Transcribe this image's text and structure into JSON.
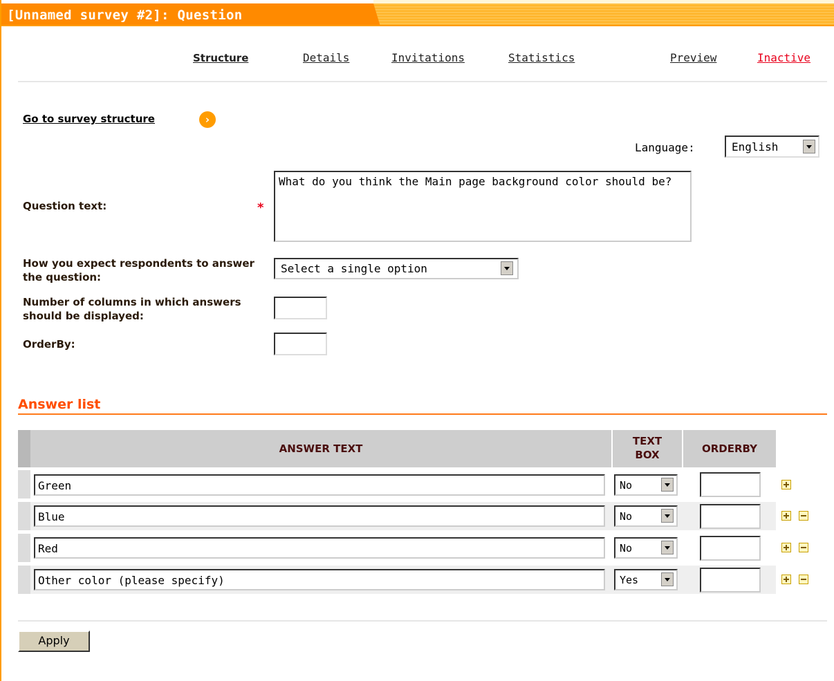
{
  "window": {
    "title": "[Unnamed survey #2]: Question"
  },
  "tabs": [
    {
      "label": "Structure",
      "active": true
    },
    {
      "label": "Details"
    },
    {
      "label": "Invitations"
    },
    {
      "label": "Statistics"
    },
    {
      "label": "Preview"
    },
    {
      "label": "Inactive",
      "color": "#e8001c"
    }
  ],
  "goto_structure": {
    "label": "Go to survey structure ",
    "icon": "arrow-right-circle-icon"
  },
  "language": {
    "label": "Language:",
    "selected": "English"
  },
  "form": {
    "question_text_label": "Question text:",
    "required_marker": "*",
    "question_text_value": "What do you think the Main page background color should be?",
    "answer_type_label": "How you expect respondents to answer the question:",
    "answer_type_selected": "Select a single option",
    "columns_label": "Number of columns in which answers should be displayed:",
    "columns_value": "",
    "orderby_label": "OrderBy:",
    "orderby_value": ""
  },
  "answer_list": {
    "title": "Answer list",
    "headers": {
      "answer_text": "ANSWER TEXT",
      "text_box": "TEXT BOX",
      "orderby": "ORDERBY"
    },
    "rows": [
      {
        "text": "Green",
        "text_box": "No",
        "orderby": ""
      },
      {
        "text": "Blue",
        "text_box": "No",
        "orderby": ""
      },
      {
        "text": "Red",
        "text_box": "No",
        "orderby": ""
      },
      {
        "text": "Other color (please specify)",
        "text_box": "Yes",
        "orderby": ""
      }
    ]
  },
  "apply_button": {
    "label": "Apply"
  },
  "colors": {
    "accent": "#ff8a00",
    "section_title": "#ff4e00",
    "inactive_link": "#e8001c"
  }
}
